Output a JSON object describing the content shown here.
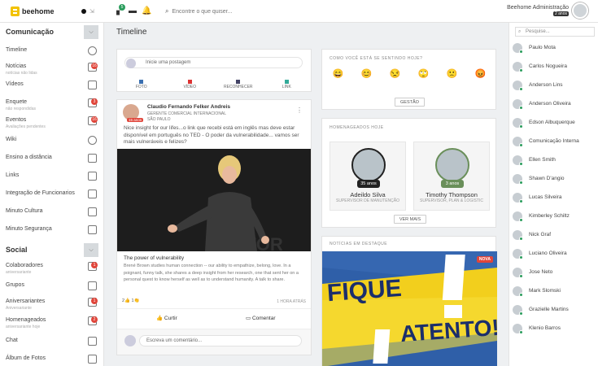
{
  "header": {
    "logo": "beehome",
    "notif_badge": "5",
    "search_placeholder": "Encontre o que quiser...",
    "user_name": "Beehome Administração",
    "user_badge": "2 anos"
  },
  "sidebar": {
    "section1": "Comunicação",
    "section2": "Social",
    "items": [
      {
        "label": "Timeline",
        "sub": "",
        "badge": ""
      },
      {
        "label": "Notícias",
        "sub": "notícias não lidas",
        "badge": "16"
      },
      {
        "label": "Vídeos",
        "sub": "",
        "badge": ""
      },
      {
        "label": "Enquete",
        "sub": "não respondidas",
        "badge": "3"
      },
      {
        "label": "Eventos",
        "sub": "Avaliações pendentes",
        "badge": "16"
      },
      {
        "label": "Wiki",
        "sub": "",
        "badge": ""
      },
      {
        "label": "Ensino a distância",
        "sub": "",
        "badge": ""
      },
      {
        "label": "Links",
        "sub": "",
        "badge": ""
      },
      {
        "label": "Integração de Funcionarios",
        "sub": "",
        "badge": ""
      },
      {
        "label": "Minuto Cultura",
        "sub": "",
        "badge": ""
      },
      {
        "label": "Minuto Segurança",
        "sub": "",
        "badge": ""
      }
    ],
    "social_items": [
      {
        "label": "Colaboradores",
        "sub": "aniversariante",
        "badge": "1"
      },
      {
        "label": "Grupos",
        "sub": "",
        "badge": ""
      },
      {
        "label": "Aniversariantes",
        "sub": "Aniversariante",
        "badge": "1"
      },
      {
        "label": "Homenageados",
        "sub": "aniversariante hoje",
        "badge": "2"
      },
      {
        "label": "Chat",
        "sub": "",
        "badge": ""
      },
      {
        "label": "Álbum de Fotos",
        "sub": "",
        "badge": ""
      }
    ]
  },
  "main": {
    "title": "Timeline",
    "post_placeholder": "Inicie uma postagem",
    "post_actions": [
      "FOTO",
      "VÍDEO",
      "RECONHECER",
      "LINK"
    ],
    "post": {
      "author": "Claudio Fernando Felker Andreis",
      "role": "GERENTE COMERCIAL INTERNACIONAL",
      "location": "SÃO PAULO",
      "avatar_badge": "15 anos",
      "text": "Nice insight for our lifes...o link que recebi está em inglês mas deve estar disponível em português no TED - O poder da vulnerabilidade... vamos ser mais vulneráveis e felizes?",
      "link_title": "The power of vulnerability",
      "link_desc": "Brené Brown studies human connection -- our ability to empathize, belong, love. In a poignant, funny talk, she shares a deep insight from her research, one that sent her on a personal quest to know herself as well as to understand humanity. A talk to share.",
      "likes": "2",
      "reactions": "1",
      "time": "1 HORA ATRÁS",
      "like_label": "Curtir",
      "comment_label": "Comentar",
      "comment_placeholder": "Escreva um comentário..."
    }
  },
  "mood": {
    "title": "COMO VOCÊ ESTÁ SE SENTINDO HOJE?",
    "emojis": [
      "😄",
      "😊",
      "😒",
      "🙄",
      "🙁",
      "😡"
    ],
    "button": "GESTÃO"
  },
  "honor": {
    "title": "HOMENAGEADOS HOJE",
    "people": [
      {
        "name": "Adeildo Silva",
        "role": "SUPERVISOR DE MANUTENÇÃO",
        "age": "35 anos",
        "color": "#222222"
      },
      {
        "name": "Timothy Thompson",
        "role": "SUPERVISOR, PLAN & LOGISTIC",
        "age": "3 anos",
        "color": "#6a8f5a"
      }
    ],
    "button": "VER MAIS"
  },
  "news": {
    "title": "NOTÍCIAS EM DESTAQUE",
    "badge": "NOVA",
    "line1": "FIQUE",
    "line2": "ATENTO!"
  },
  "contacts": {
    "search_placeholder": "Pesquise...",
    "people": [
      "Paulo Mota",
      "Carlos Nogueira",
      "Anderson Lins",
      "Anderson Oliveira",
      "Edson Albuquerque",
      "Comunicação Interna",
      "Ellen Smith",
      "Shawn D'angio",
      "Lucas Silveira",
      "Kimberley Schiltz",
      "Nick Graf",
      "Luciano Oliveira",
      "Jose Neto",
      "Mark Slomski",
      "Grazielle Martins",
      "Klenio Barros"
    ]
  }
}
